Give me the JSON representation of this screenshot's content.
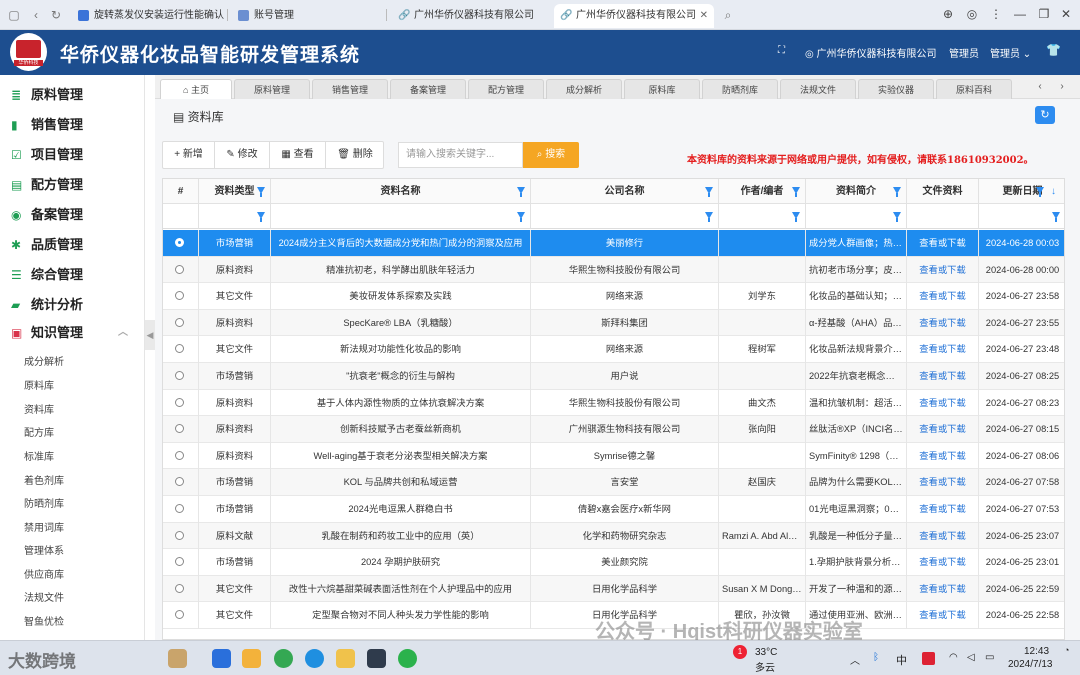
{
  "browser": {
    "tabs": [
      {
        "label": "旋转蒸发仪安装运行性能确认 - 百"
      },
      {
        "label": "账号管理"
      },
      {
        "label": "广州华侨仪器科技有限公司"
      },
      {
        "label": "广州华侨仪器科技有限公司"
      }
    ]
  },
  "header": {
    "logo_text": "华侨科技",
    "title": "华侨仪器化妆品智能研发管理系统",
    "company": "广州华侨仪器科技有限公司",
    "role": "管理员",
    "user_menu": "管理员"
  },
  "sidebar": {
    "items": [
      {
        "label": "原料管理",
        "icon": "database-icon"
      },
      {
        "label": "销售管理",
        "icon": "book-icon"
      },
      {
        "label": "项目管理",
        "icon": "checklist-icon"
      },
      {
        "label": "配方管理",
        "icon": "document-icon"
      },
      {
        "label": "备案管理",
        "icon": "badge-icon"
      },
      {
        "label": "品质管理",
        "icon": "gear-icon"
      },
      {
        "label": "综合管理",
        "icon": "menu-icon"
      },
      {
        "label": "统计分析",
        "icon": "truck-icon"
      },
      {
        "label": "知识管理",
        "icon": "briefcase-icon"
      }
    ],
    "sub_items": [
      "成分解析",
      "原料库",
      "资料库",
      "配方库",
      "标准库",
      "着色剂库",
      "防晒剂库",
      "禁用词库",
      "管理体系",
      "供应商库",
      "法规文件",
      "智鱼优检"
    ]
  },
  "page_tabs": [
    "主页",
    "原料管理",
    "销售管理",
    "备案管理",
    "配方管理",
    "成分解析",
    "原料库",
    "防晒剂库",
    "法规文件",
    "实验仪器",
    "原料百科"
  ],
  "breadcrumb": "资料库",
  "toolbar": {
    "add": "新增",
    "edit": "修改",
    "view": "查看",
    "delete": "删除",
    "search_placeholder": "请输入搜索关键字...",
    "search_button": "搜索"
  },
  "notice": "本资料库的资料来源于网络或用户提供，如有侵权，请联系18610932002。",
  "table": {
    "headers": [
      "#",
      "资料类型",
      "资料名称",
      "公司名称",
      "作者/编者",
      "资料简介",
      "文件资料",
      "更新日期"
    ],
    "rows": [
      [
        "市场营销",
        "2024成分主义背后的大数据成分党和热门成分的洞察及应用",
        "美丽修行",
        "",
        "成分党人群画像；热…",
        "查看或下载",
        "2024-06-28 00:03"
      ],
      [
        "原料资料",
        "精准抗初老，科学酵出肌肤年轻活力",
        "华熙生物科技股份有限公司",
        "",
        "抗初老市场分享；皮…",
        "查看或下载",
        "2024-06-28 00:00"
      ],
      [
        "其它文件",
        "美妆研发体系探索及实践",
        "网络来源",
        "刘学东",
        "化妆品的基础认知；…",
        "查看或下载",
        "2024-06-27 23:58"
      ],
      [
        "原料资料",
        "SpecKare® LBA（乳糖酸）",
        "斯拜科集团",
        "",
        "α-羟基酸（AHA）品…",
        "查看或下载",
        "2024-06-27 23:55"
      ],
      [
        "其它文件",
        "新法规对功能性化妆品的影响",
        "网络来源",
        "程树军",
        "化妆品新法规背景介…",
        "查看或下载",
        "2024-06-27 23:48"
      ],
      [
        "市场营销",
        "\"抗衰老\"概念的衍生与解构",
        "用户说",
        "",
        "2022年抗衰老概念…",
        "查看或下载",
        "2024-06-27 08:25"
      ],
      [
        "原料资料",
        "基于人体内源性物质的立体抗衰解决方案",
        "华熙生物科技股份有限公司",
        "曲文杰",
        "温和抗皱机制：超活…",
        "查看或下载",
        "2024-06-27 08:23"
      ],
      [
        "原料资料",
        "创新科技赋予古老蚕丝新商机",
        "广州骐源生物科技有限公司",
        "张向阳",
        "丝肽活®XP（INCI名…",
        "查看或下载",
        "2024-06-27 08:15"
      ],
      [
        "原料资料",
        "Well-aging基于衰老分泌表型相关解决方案",
        "Symrise德之馨",
        "",
        "SymFinity® 1298（…",
        "查看或下载",
        "2024-06-27 08:06"
      ],
      [
        "市场营销",
        "KOL 与品牌共创和私域运营",
        "言安堂",
        "赵国庆",
        "品牌为什么需要KOL…",
        "查看或下载",
        "2024-06-27 07:58"
      ],
      [
        "市场营销",
        "2024光电逗黑人群稳白书",
        "倩碧x嘉会医疗x新华网",
        "",
        "01光电逗黑洞察；0…",
        "查看或下载",
        "2024-06-27 07:53"
      ],
      [
        "原料文献",
        "乳酸在制药和药妆工业中的应用（英）",
        "化学和药物研究杂志",
        "Ramzi A. Abd Als…",
        "乳酸是一种低分子量…",
        "查看或下载",
        "2024-06-25 23:07"
      ],
      [
        "市场营销",
        "2024 孕期护肤研究",
        "美业颜究院",
        "",
        "1.孕期护肤背景分析…",
        "查看或下载",
        "2024-06-25 23:01"
      ],
      [
        "其它文件",
        "改性十六烷基甜菜碱表面活性剂在个人护理品中的应用",
        "日用化学品科学",
        "Susan X M Dong,…",
        "开发了一种温和的源…",
        "查看或下载",
        "2024-06-25 22:59"
      ],
      [
        "其它文件",
        "定型聚合物对不同人种头发力学性能的影响",
        "日用化学品科学",
        "瞿欣，孙汝微",
        "通过使用亚洲、欧洲…",
        "查看或下载",
        "2024-06-25 22:58"
      ]
    ]
  },
  "taskbar": {
    "weather_temp": "33°C",
    "weather_desc": "多云",
    "ime": "中",
    "time": "12:43",
    "date": "2024/7/13"
  },
  "watermark": "公众号 · Hqist科研仪器实验室",
  "watermark_left": "大数跨境"
}
